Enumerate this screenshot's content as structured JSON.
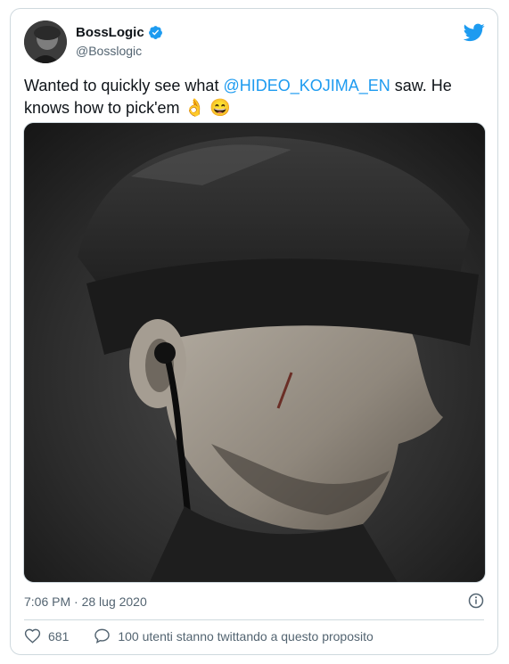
{
  "author": {
    "name": "BossLogic",
    "handle": "@Bosslogic",
    "verified_icon": "verified-badge-icon",
    "avatar": "profile-avatar"
  },
  "tweet": {
    "text_before": "Wanted to quickly see what ",
    "mention": "@HIDEO_KOJIMA_EN",
    "text_after": " saw. He knows how to pick'em ",
    "emojis": [
      "👌",
      "😄"
    ]
  },
  "media": {
    "description_icon": "photo-image"
  },
  "meta": {
    "timestamp": "7:06 PM · 28 lug 2020"
  },
  "actions": {
    "likes": "681",
    "conversation": "100 utenti stanno twittando a questo proposito"
  },
  "colors": {
    "accent": "#1d9bf0",
    "muted": "#536471",
    "border": "#cfd9de"
  }
}
